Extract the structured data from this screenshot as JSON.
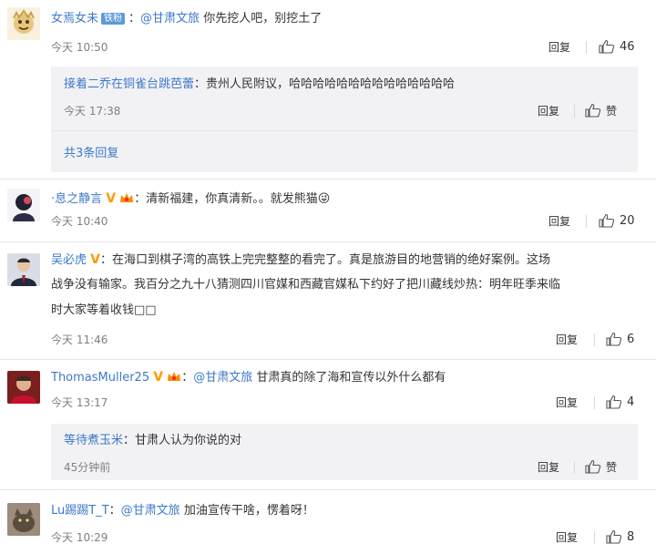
{
  "comments": [
    {
      "user": "女焉女未",
      "badge": "铁粉",
      "mention": "@甘肃文旅",
      "text": "你先挖人吧，别挖土了",
      "time": "今天 10:50",
      "reply_label": "回复",
      "likes": "46",
      "sub_replies": [
        {
          "user": "接着二乔在铜雀台跳芭蕾",
          "text": "贵州人民附议，哈哈哈哈哈哈哈哈哈哈哈哈哈哈",
          "time": "今天 17:38",
          "reply_label": "回复",
          "like_label": "赞"
        }
      ],
      "more_replies": "共3条回复"
    },
    {
      "user": "·息之静言",
      "text": "清新福建，你真清新。。就发熊猫😜",
      "time": "今天 10:40",
      "reply_label": "回复",
      "likes": "20"
    },
    {
      "user": "吴必虎",
      "text_lines": [
        "在海口到棋子湾的高铁上完完整整的看完了。真是旅游目的地营销的绝好案例。这场",
        "战争没有输家。我百分之九十八猜测四川官媒和西藏官媒私下约好了把川藏线炒热：明年旺季来临",
        "时大家等着收钱□□"
      ],
      "time": "今天 11:46",
      "reply_label": "回复",
      "likes": "6"
    },
    {
      "user": "ThomasMuller25",
      "mention": "@甘肃文旅",
      "text": "甘肃真的除了海和宣传以外什么都有",
      "time": "今天 13:17",
      "reply_label": "回复",
      "likes": "4",
      "sub_replies": [
        {
          "user": "等待煮玉米",
          "text": "甘肃人认为你说的对",
          "time": "45分钟前",
          "reply_label": "回复",
          "like_label": "赞"
        }
      ]
    },
    {
      "user": "Lu踢踢T_T",
      "mention": "@甘肃文旅",
      "text": "加油宣传干啥，愣着呀！",
      "time": "今天 10:29",
      "reply_label": "回复",
      "likes": "8"
    }
  ],
  "colors": {
    "link": "#3d79c9",
    "vip": "#ff9900",
    "sub_bg": "#f2f2f5"
  },
  "icons": {
    "like": "thumbs-up-icon",
    "vip": "vip-v-icon",
    "crown": "crown-icon"
  }
}
